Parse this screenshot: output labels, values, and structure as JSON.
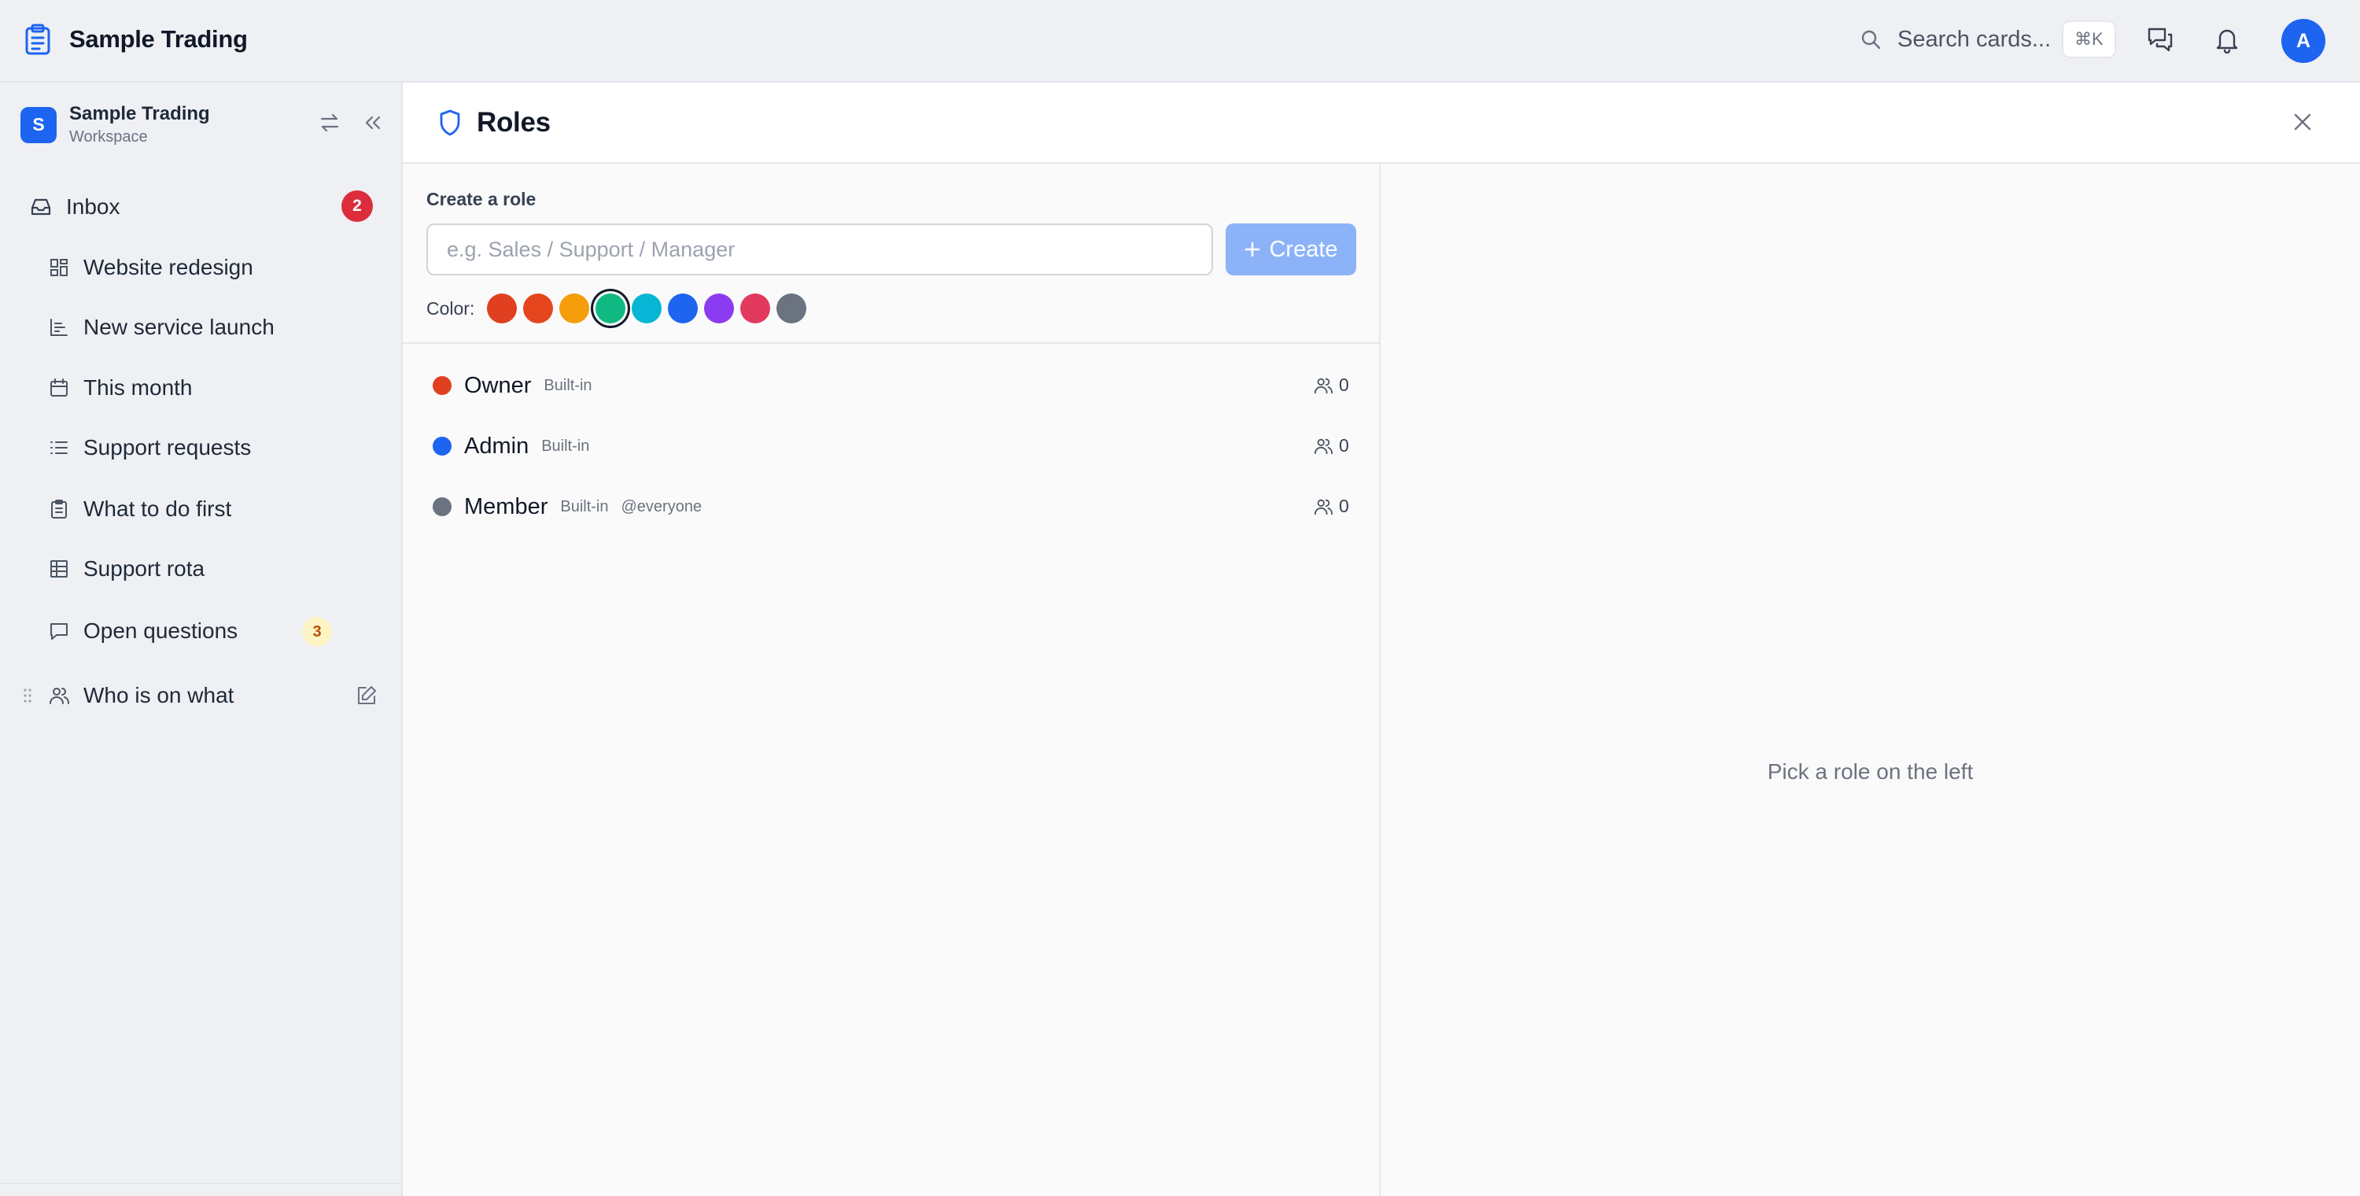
{
  "app": {
    "title": "Sample Trading",
    "search_placeholder": "Search cards...",
    "search_shortcut": "⌘K",
    "avatar_initial": "A"
  },
  "sidebar": {
    "workspace": {
      "initial": "S",
      "name": "Sample Trading",
      "subtitle": "Workspace"
    },
    "inbox": {
      "label": "Inbox",
      "count": "2"
    },
    "items": [
      {
        "label": "Website redesign",
        "icon": "board-icon"
      },
      {
        "label": "New service launch",
        "icon": "chart-icon"
      },
      {
        "label": "This month",
        "icon": "calendar-icon"
      },
      {
        "label": "Support requests",
        "icon": "list-icon"
      },
      {
        "label": "What to do first",
        "icon": "clipboard-icon"
      },
      {
        "label": "Support rota",
        "icon": "table-icon"
      },
      {
        "label": "Open questions",
        "icon": "chat-icon",
        "badge": "3"
      },
      {
        "label": "Who is on what",
        "icon": "users-icon"
      }
    ]
  },
  "roles_panel": {
    "title": "Roles",
    "create_label": "Create a role",
    "input_placeholder": "e.g. Sales / Support / Manager",
    "create_button": "Create",
    "color_label": "Color:",
    "colors": [
      "#e0401f",
      "#e5461e",
      "#f59e0b",
      "#10b981",
      "#06b6d4",
      "#1d64f0",
      "#8b3cf0",
      "#e23a5f",
      "#6b7280"
    ],
    "selected_color_index": 3,
    "roles": [
      {
        "name": "Owner",
        "color": "#e0401f",
        "tags": [
          "Built-in"
        ],
        "members": "0"
      },
      {
        "name": "Admin",
        "color": "#1d64f0",
        "tags": [
          "Built-in"
        ],
        "members": "0"
      },
      {
        "name": "Member",
        "color": "#6b7280",
        "tags": [
          "Built-in",
          "@everyone"
        ],
        "members": "0"
      }
    ],
    "empty_detail": "Pick a role on the left"
  }
}
